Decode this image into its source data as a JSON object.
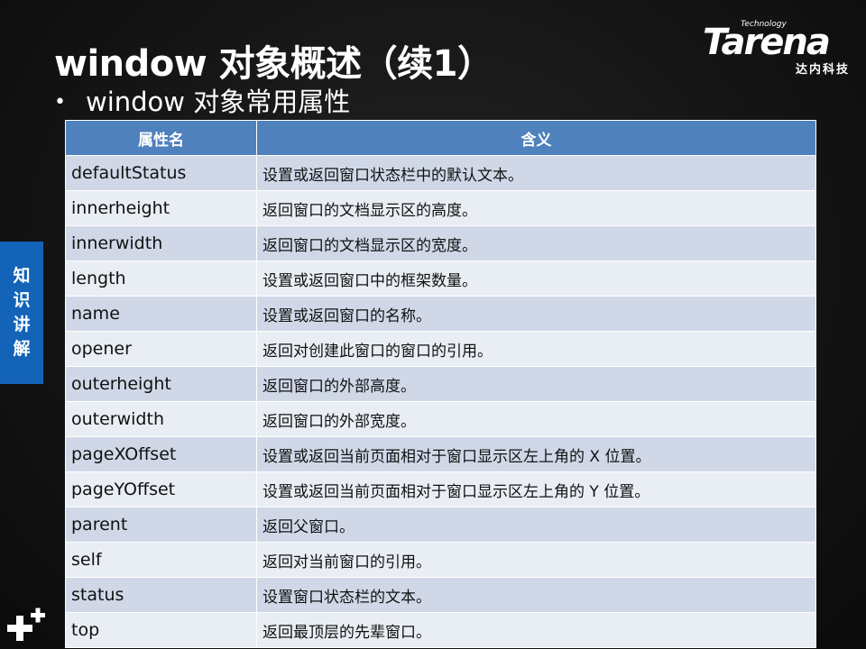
{
  "slide": {
    "title": "window 对象概述（续1）",
    "subtitle": "window 对象常用属性",
    "side_tab": [
      "知",
      "识",
      "讲",
      "解"
    ]
  },
  "logo": {
    "tagline": "Technology",
    "name": "Tarena",
    "cn": "达内科技"
  },
  "table": {
    "headers": [
      "属性名",
      "含义"
    ],
    "rows": [
      {
        "name": "defaultStatus",
        "meaning": "设置或返回窗口状态栏中的默认文本。"
      },
      {
        "name": "innerheight",
        "meaning": "返回窗口的文档显示区的高度。"
      },
      {
        "name": "innerwidth",
        "meaning": "返回窗口的文档显示区的宽度。"
      },
      {
        "name": "length",
        "meaning": "设置或返回窗口中的框架数量。"
      },
      {
        "name": "name",
        "meaning": "设置或返回窗口的名称。"
      },
      {
        "name": "opener",
        "meaning": "返回对创建此窗口的窗口的引用。"
      },
      {
        "name": "outerheight",
        "meaning": "返回窗口的外部高度。"
      },
      {
        "name": "outerwidth",
        "meaning": "返回窗口的外部宽度。"
      },
      {
        "name": "pageXOffset",
        "meaning": "设置或返回当前页面相对于窗口显示区左上角的 X 位置。"
      },
      {
        "name": "pageYOffset",
        "meaning": "设置或返回当前页面相对于窗口显示区左上角的 Y 位置。"
      },
      {
        "name": "parent",
        "meaning": "返回父窗口。"
      },
      {
        "name": "self",
        "meaning": "返回对当前窗口的引用。"
      },
      {
        "name": "status",
        "meaning": "设置窗口状态栏的文本。"
      },
      {
        "name": "top",
        "meaning": "返回最顶层的先辈窗口。"
      }
    ]
  },
  "colors": {
    "header_bg": "#4f81bd",
    "row_odd": "#d0d8e8",
    "row_even": "#e9edf4",
    "side_tab": "#1363b8"
  },
  "icons": {
    "bullet": "bullet-icon",
    "corner": "plus-icon"
  }
}
